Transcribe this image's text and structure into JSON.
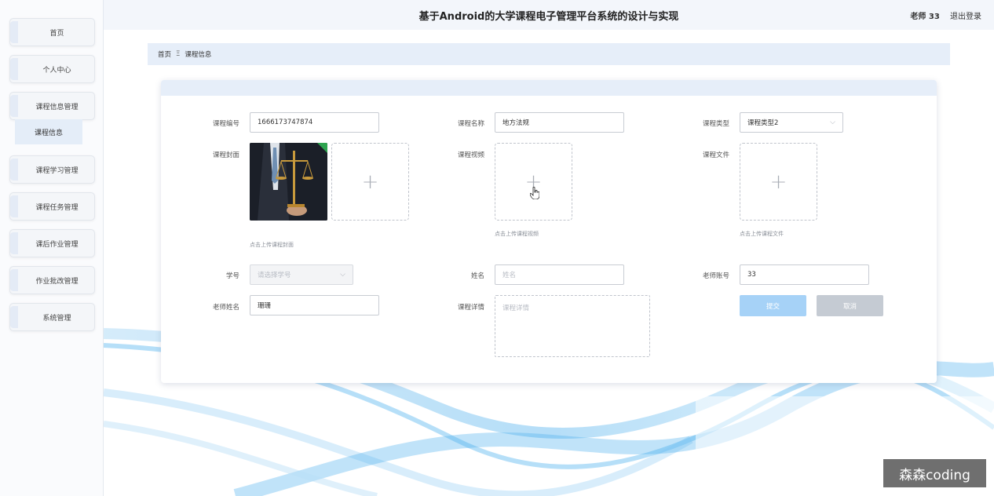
{
  "header": {
    "title": "基于Android的大学课程电子管理平台系统的设计与实现",
    "user_label": "老师 33",
    "logout_label": "退出登录"
  },
  "sidebar": {
    "items": [
      {
        "label": "首页"
      },
      {
        "label": "个人中心"
      },
      {
        "label": "课程信息管理"
      },
      {
        "label": "课程学习管理"
      },
      {
        "label": "课程任务管理"
      },
      {
        "label": "课后作业管理"
      },
      {
        "label": "作业批改管理"
      },
      {
        "label": "系统管理"
      }
    ],
    "sub_item": "课程信息"
  },
  "breadcrumb": {
    "home": "首页",
    "separator": "Ξ",
    "current": "课程信息"
  },
  "form": {
    "course_no": {
      "label": "课程编号",
      "value": "1666173747874"
    },
    "course_name": {
      "label": "课程名称",
      "value": "地方法规"
    },
    "course_type": {
      "label": "课程类型",
      "value": "课程类型2"
    },
    "course_cover": {
      "label": "课程封面",
      "hint": "点击上传课程封面"
    },
    "course_video": {
      "label": "课程视频",
      "hint": "点击上传课程视频"
    },
    "course_file": {
      "label": "课程文件",
      "hint": "点击上传课程文件"
    },
    "student_no": {
      "label": "学号",
      "placeholder": "请选择学号"
    },
    "student_name": {
      "label": "姓名",
      "placeholder": "姓名"
    },
    "teacher_account": {
      "label": "老师账号",
      "value": "33"
    },
    "teacher_name": {
      "label": "老师姓名",
      "value": "珊珊"
    },
    "course_detail": {
      "label": "课程详情",
      "placeholder": "课程详情"
    },
    "submit_label": "提交",
    "cancel_label": "取消"
  },
  "watermark": "森森coding",
  "colors": {
    "accent": "#a6d2f7",
    "breadcrumb_bg": "#e6eef9",
    "cancel": "#c5cbd3"
  }
}
